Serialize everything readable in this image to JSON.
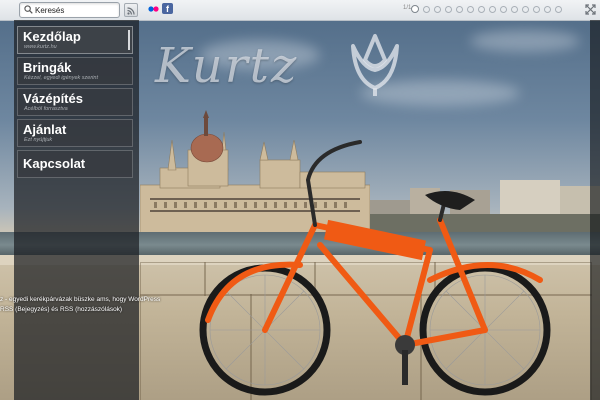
{
  "search": {
    "placeholder": "Keresés",
    "value": ""
  },
  "social": {
    "facebook_glyph": "f"
  },
  "pager": {
    "label": "1/1",
    "count": 14,
    "active_index": 0
  },
  "logo": {
    "text": "Kurtz"
  },
  "menu": [
    {
      "label": "Kezdőlap",
      "sub": "www.kurtz.hu",
      "active": true
    },
    {
      "label": "Bringák",
      "sub": "Kézzel, egyedi igények szerint",
      "active": false
    },
    {
      "label": "Vázépítés",
      "sub": "Acélból forrasztva",
      "active": false
    },
    {
      "label": "Ajánlat",
      "sub": "Ezt nyújtjuk",
      "active": false
    },
    {
      "label": "Kapcsolat",
      "sub": "",
      "active": false
    }
  ],
  "footer": {
    "line1": "z - egyedi kerékpárvázak büszke ams, hogy WordPress",
    "line2": "RSS (Bejegyzés) és RSS (hozzászólások)"
  },
  "colors": {
    "bike_orange": "#f05a14",
    "sidebar_bg": "#1c1e22",
    "topbar_bg": "#e6e9ec"
  },
  "icons": [
    "search-icon",
    "rss-icon",
    "flickr-icon",
    "facebook-icon",
    "fullscreen-icon",
    "tulip-logo-icon"
  ]
}
